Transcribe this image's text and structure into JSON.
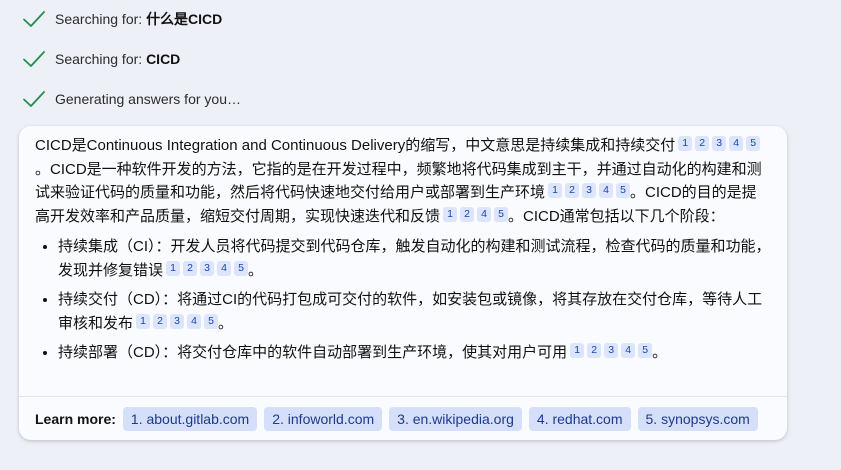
{
  "status": [
    {
      "prefix": "Searching for: ",
      "query": "什么是CICD"
    },
    {
      "prefix": "Searching for: ",
      "query": "CICD"
    },
    {
      "prefix": "Generating answers for you…",
      "query": ""
    }
  ],
  "answer": {
    "intro_1": "CICD是Continuous Integration and Continuous Delivery的缩写，中文意思是持续集成和持续交付",
    "intro_1_refs": [
      "1",
      "2",
      "3",
      "4",
      "5"
    ],
    "intro_2": "。CICD是一种软件开发的方法，它指的是在开发过程中，频繁地将代码集成到主干，并通过自动化的构建和测试来验证代码的质量和功能，然后将代码快速地交付给用户或部署到生产环境",
    "intro_2_refs": [
      "1",
      "2",
      "3",
      "4",
      "5"
    ],
    "intro_3": "。CICD的目的是提高开发效率和产品质量，缩短交付周期，实现快速迭代和反馈",
    "intro_3_refs": [
      "1",
      "2",
      "4",
      "5"
    ],
    "intro_4": "。CICD通常包括以下几个阶段：",
    "stages": [
      {
        "text": "持续集成（CI）：开发人员将代码提交到代码仓库，触发自动化的构建和测试流程，检查代码的质量和功能，发现并修复错误",
        "refs": [
          "1",
          "2",
          "3",
          "4",
          "5"
        ],
        "end": "。"
      },
      {
        "text": "持续交付（CD）：将通过CI的代码打包成可交付的软件，如安装包或镜像，将其存放在交付仓库，等待人工审核和发布",
        "refs": [
          "1",
          "2",
          "3",
          "4",
          "5"
        ],
        "end": "。"
      },
      {
        "text": "持续部署（CD）：将交付仓库中的软件自动部署到生产环境，使其对用户可用",
        "refs": [
          "1",
          "2",
          "3",
          "4",
          "5"
        ],
        "end": "。"
      }
    ]
  },
  "learn_more": {
    "label": "Learn more:",
    "links": [
      "1. about.gitlab.com",
      "2. infoworld.com",
      "3. en.wikipedia.org",
      "4. redhat.com",
      "5. synopsys.com"
    ]
  },
  "colors": {
    "check": "#1f8f4a",
    "chip_bg": "#d5dffa",
    "ref_bg": "#dce5fb"
  }
}
